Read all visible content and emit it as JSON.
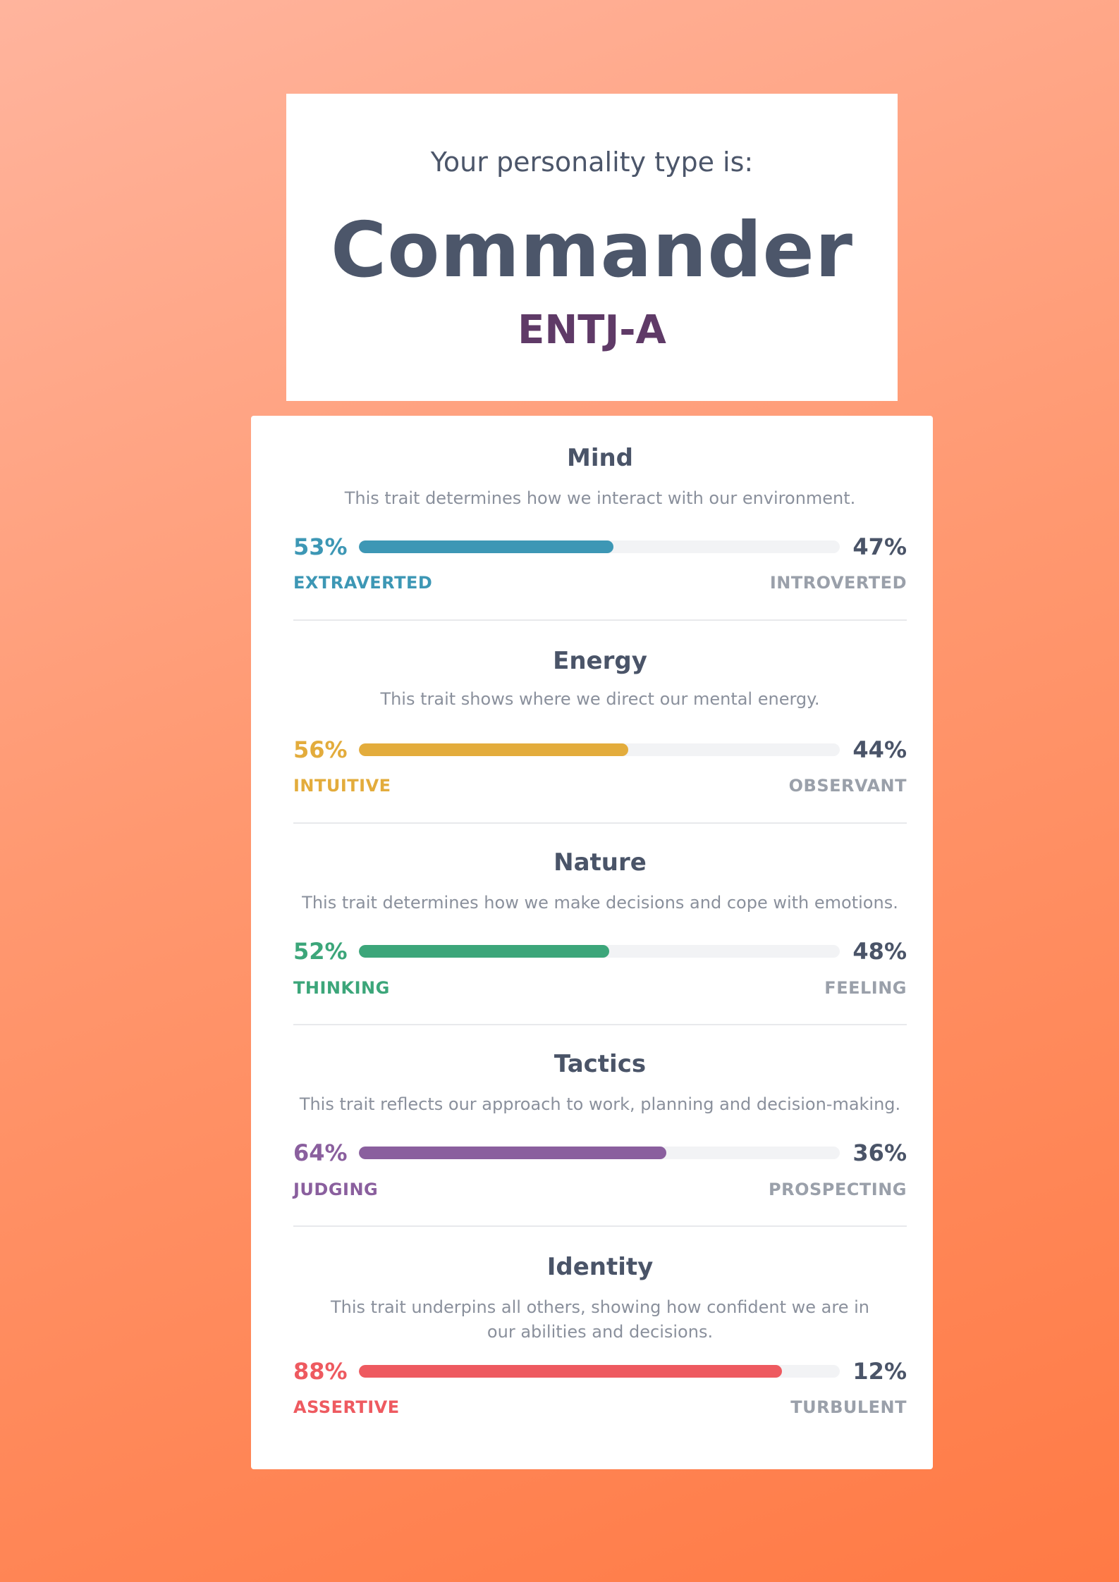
{
  "header": {
    "subtitle": "Your personality type is:",
    "title": "Commander",
    "code": "ENTJ-A"
  },
  "traits": [
    {
      "title": "Mind",
      "description": "This trait determines how we interact with our environment.",
      "left_pct": "53%",
      "right_pct": "47%",
      "left_label": "EXTRAVERTED",
      "right_label": "INTROVERTED",
      "fill_fraction": 0.53,
      "color": "#3d97b5"
    },
    {
      "title": "Energy",
      "description": "This trait shows where we direct our mental energy.",
      "left_pct": "56%",
      "right_pct": "44%",
      "left_label": "INTUITIVE",
      "right_label": "OBSERVANT",
      "fill_fraction": 0.56,
      "color": "#e3ac3c"
    },
    {
      "title": "Nature",
      "description": "This trait determines how we make decisions and cope with emotions.",
      "left_pct": "52%",
      "right_pct": "48%",
      "left_label": "THINKING",
      "right_label": "FEELING",
      "fill_fraction": 0.52,
      "color": "#3ca67a"
    },
    {
      "title": "Tactics",
      "description": "This trait reflects our approach to work, planning and decision-making.",
      "left_pct": "64%",
      "right_pct": "36%",
      "left_label": "JUDGING",
      "right_label": "PROSPECTING",
      "fill_fraction": 0.64,
      "color": "#8a5f9e"
    },
    {
      "title": "Identity",
      "description": "This trait underpins all others, showing how confident we are in our abilities and decisions.",
      "left_pct": "88%",
      "right_pct": "12%",
      "left_label": "ASSERTIVE",
      "right_label": "TURBULENT",
      "fill_fraction": 0.88,
      "color": "#ee5a60"
    }
  ]
}
